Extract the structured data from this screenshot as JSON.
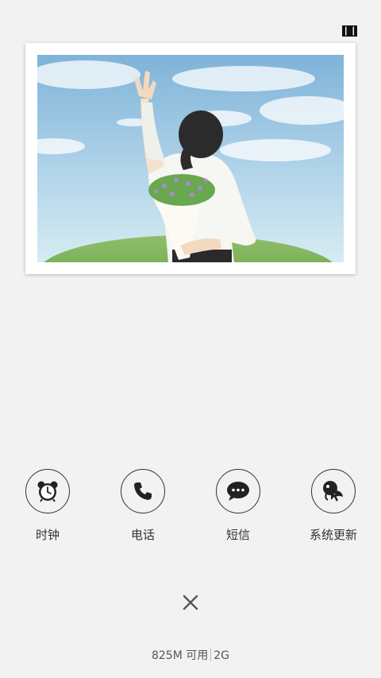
{
  "topbar": {
    "layout_icon": "multiwindow-layout-icon"
  },
  "photo": {
    "subject": "photo-icon"
  },
  "apps": [
    {
      "label": "时钟",
      "icon": "alarm-clock-icon"
    },
    {
      "label": "电话",
      "icon": "phone-icon"
    },
    {
      "label": "短信",
      "icon": "message-icon"
    },
    {
      "label": "系统更新",
      "icon": "system-update-icon"
    }
  ],
  "close": {
    "icon": "close-icon"
  },
  "status": {
    "memory": "825M 可用",
    "network": "2G"
  }
}
